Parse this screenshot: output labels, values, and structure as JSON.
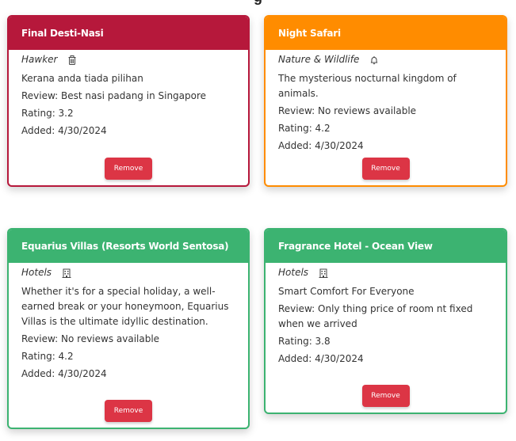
{
  "header": {
    "title_partial": "g"
  },
  "cards": [
    {
      "title": "Final Desti-Nasi",
      "category": "Hawker",
      "icon": "trash-can-icon",
      "description": "Kerana anda tiada pilihan",
      "review": "Review: Best nasi padang in Singapore",
      "rating": "Rating: 3.2",
      "added": "Added: 4/30/2024",
      "button": "Remove",
      "color": "#b6183b"
    },
    {
      "title": "Night Safari",
      "category": "Nature & Wildlife",
      "icon": "bell-icon",
      "description": "The mysterious nocturnal kingdom of animals.",
      "review": "Review: No reviews available",
      "rating": "Rating: 4.2",
      "added": "Added: 4/30/2024",
      "button": "Remove",
      "color": "#ff8c00"
    },
    {
      "title": "Equarius Villas (Resorts World Sentosa)",
      "category": "Hotels",
      "icon": "building-icon",
      "description": "Whether it's for a special holiday, a well-earned break or your honeymoon, Equarius Villas is the ultimate idyllic destination.",
      "review": "Review: No reviews available",
      "rating": "Rating: 4.2",
      "added": "Added: 4/30/2024",
      "button": "Remove",
      "color": "#3cb371"
    },
    {
      "title": "Fragrance Hotel - Ocean View",
      "category": "Hotels",
      "icon": "building-icon",
      "description": "Smart Comfort For Everyone",
      "review": "Review: Only thing price of room nt fixed when we arrived",
      "rating": "Rating: 3.8",
      "added": "Added: 4/30/2024",
      "button": "Remove",
      "color": "#3cb371"
    }
  ]
}
